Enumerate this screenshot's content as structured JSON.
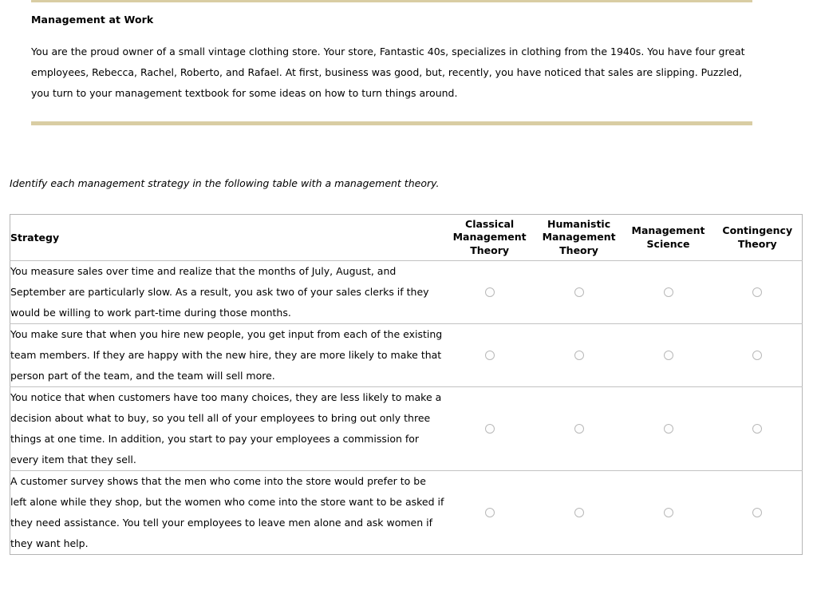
{
  "case": {
    "title": "Management at Work",
    "paragraph": "You are the proud owner of a small vintage clothing store. Your store, Fantastic 40s, specializes in clothing from the 1940s. You have four great employees, Rebecca, Rachel, Roberto, and Rafael. At first, business was good, but, recently, you have noticed that sales are slipping. Puzzled, you turn to your management textbook for some ideas on how to turn things around.",
    "rule_color": "#d9cda3"
  },
  "instruction": "Identify each management strategy in the following table with a management theory.",
  "table": {
    "strategy_header": "Strategy",
    "columns": [
      "Classical Management Theory",
      "Humanistic Management Theory",
      "Management Science",
      "Contingency Theory"
    ],
    "rows": [
      {
        "strategy": "You measure sales over time and realize that the months of July, August, and September are particularly slow. As a result, you ask two of your sales clerks if they would be willing to work part-time during those months.",
        "selected": null
      },
      {
        "strategy": "You make sure that when you hire new people, you get input from each of the existing team members. If they are happy with the new hire, they are more likely to make that person part of the team, and the team will sell more.",
        "selected": null
      },
      {
        "strategy": "You notice that when customers have too many choices, they are less likely to make a decision about what to buy, so you tell all of your employees to bring out only three things at one time. In addition, you start to pay your employees a commission for every item that they sell.",
        "selected": null
      },
      {
        "strategy": "A customer survey shows that the men who come into the store would prefer to be left alone while they shop, but the women who come into the store want to be asked if they need assistance. You tell your employees to leave men alone and ask women if they want help.",
        "selected": null
      }
    ],
    "border_color": "#b5b5b5",
    "radio_border_color": "#b9b9b9"
  }
}
